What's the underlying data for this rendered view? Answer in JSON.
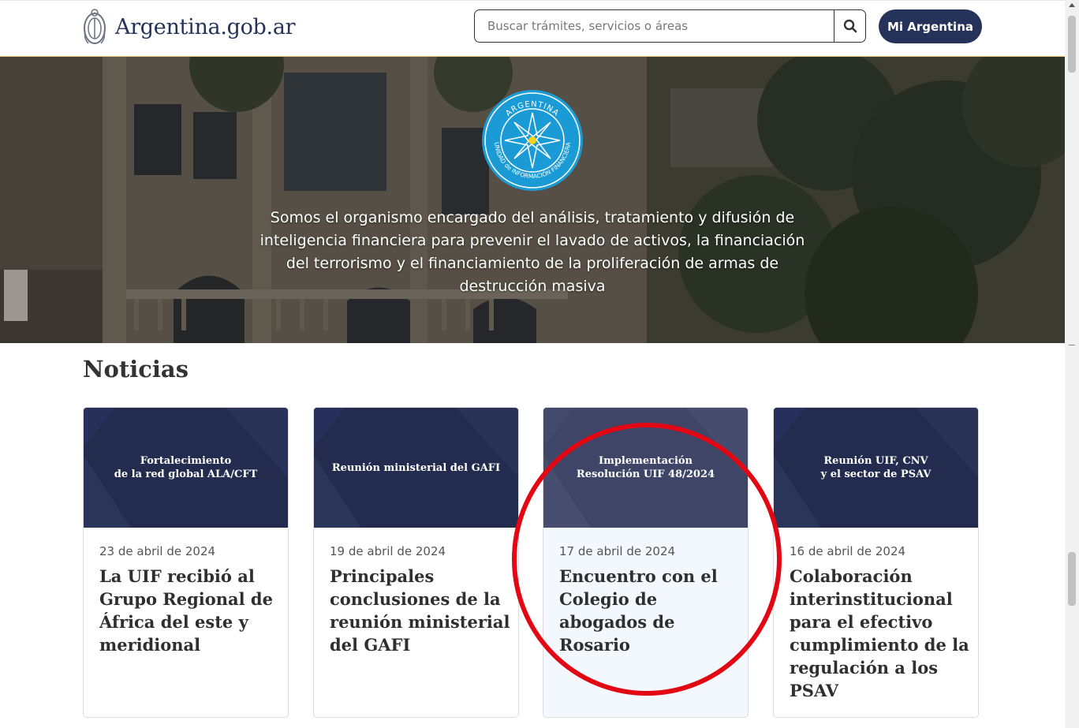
{
  "header": {
    "brand": "Argentina.gob.ar",
    "search_placeholder": "Buscar trámites, servicios o áreas",
    "search_icon": "search-icon",
    "account_button": "Mi Argentina"
  },
  "hero": {
    "logo_text_top": "ARGENTINA",
    "logo_text_bottom": "UNIDAD de INFORMACIÓN FINANCIERA",
    "description": "Somos el organismo encargado del análisis, tratamiento y difusión de inteligencia financiera para prevenir el lavado de activos, la financiación del terrorismo y el financiamiento de la proliferación de armas de destrucción masiva"
  },
  "news": {
    "title": "Noticias",
    "items": [
      {
        "image_text": "Fortalecimiento\nde la red global ALA/CFT",
        "date": "23 de abril de 2024",
        "title": "La UIF recibió al Grupo Regional de África del este y meridional"
      },
      {
        "image_text": "Reunión ministerial del GAFI",
        "date": "19 de abril de 2024",
        "title": "Principales conclusiones de la reunión ministerial del GAFI"
      },
      {
        "image_text": "Implementación\nResolución UIF 48/2024",
        "date": "17 de abril de 2024",
        "title": "Encuentro con el Colegio de abogados de Rosario"
      },
      {
        "image_text": "Reunión UIF, CNV\ny el sector de PSAV",
        "date": "16 de abril de 2024",
        "title": "Colaboración interinstitucional para el efectivo cumplimiento de la regulación a los PSAV"
      }
    ]
  },
  "colors": {
    "brand_navy": "#253259",
    "header_accent": "#f0c36a",
    "card_image_bg": "#232b4e",
    "annotation_red": "#e30613"
  }
}
